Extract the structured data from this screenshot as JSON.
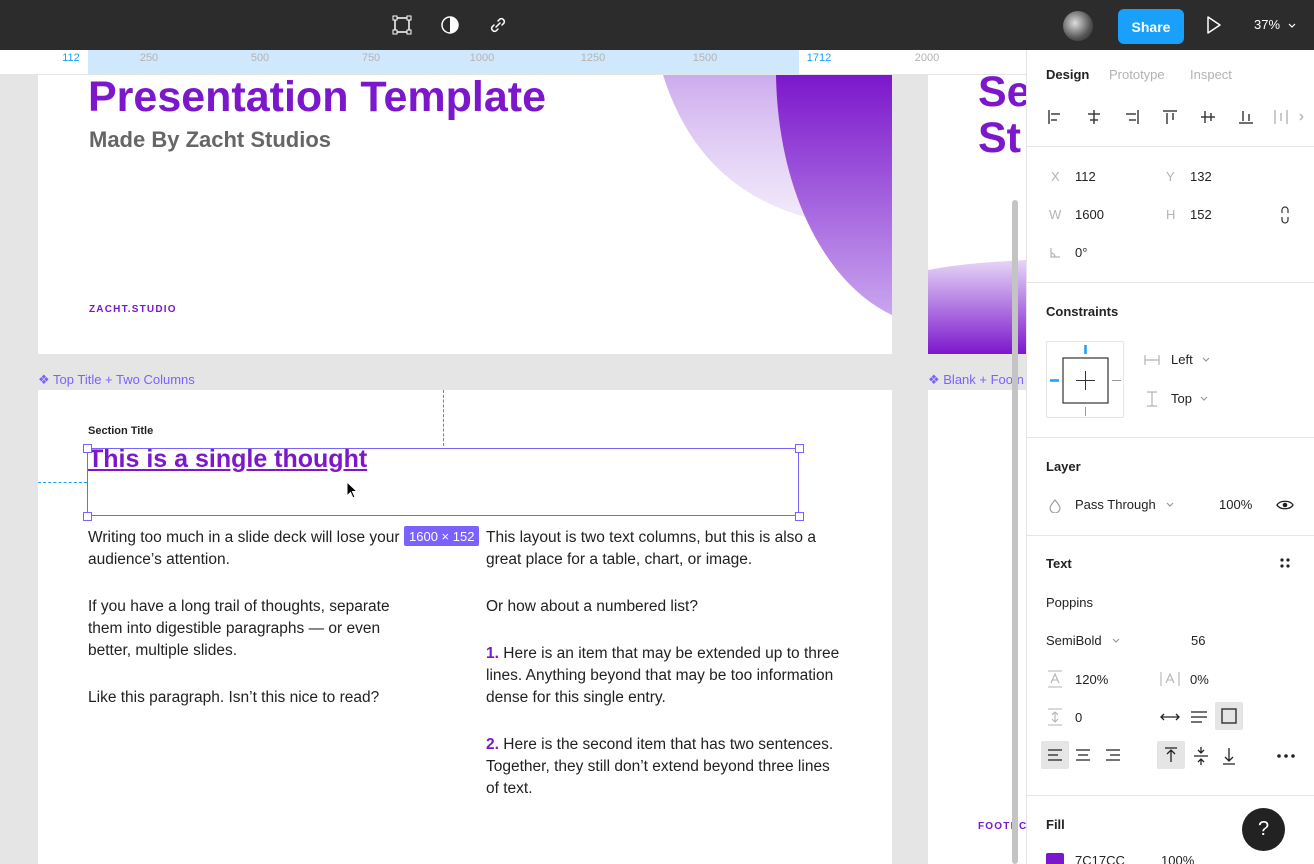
{
  "toolbar": {
    "share_label": "Share",
    "zoom": "37%",
    "icons": [
      "frame-icon",
      "contrast-icon",
      "link-icon",
      "play-icon"
    ]
  },
  "ruler": {
    "ticks": [
      "112",
      "250",
      "500",
      "750",
      "1000",
      "1250",
      "1500",
      "1712",
      "2000"
    ],
    "selected_start": "112",
    "selected_end": "1712"
  },
  "canvas": {
    "frame1": {
      "title": "Presentation Template",
      "subtitle": "Made By Zacht Studios",
      "footer": "ZACHT.STUDIO"
    },
    "frame3": {
      "title_line1": "Se",
      "title_line2": "St"
    },
    "frame2": {
      "label": "❖ Top Title + Two Columns",
      "section_title": "Section Title",
      "heading": "This is a single thought",
      "left_col": [
        "Writing too much in a slide deck will lose your audience’s attention.",
        "If you have a long trail of thoughts, separate them into digestible paragraphs — or even better, multiple slides.",
        "Like this paragraph. Isn’t this nice to read?"
      ],
      "right_col": {
        "p1": "This layout is two text columns, but this is also a great place for a table, chart, or image.",
        "p2": "Or how about a numbered list?",
        "item1_num": "1.",
        "item1": "Here is an item that may be extended up to three lines. Anything beyond that may be too information dense for this single entry.",
        "item2_num": "2.",
        "item2": "Here is the second item that has two sentences. Together, they still don’t extend beyond three lines of text."
      }
    },
    "frame4": {
      "label": "❖ Blank + Footn",
      "footer": "FOOTNC"
    },
    "selection_size": "1600 × 152"
  },
  "panel": {
    "tabs": [
      "Design",
      "Prototype",
      "Inspect"
    ],
    "x_label": "X",
    "x": "112",
    "y_label": "Y",
    "y": "132",
    "w_label": "W",
    "w": "1600",
    "h_label": "H",
    "h": "152",
    "rotation": "0°",
    "constraints": {
      "title": "Constraints",
      "horizontal": "Left",
      "vertical": "Top"
    },
    "layer": {
      "title": "Layer",
      "blend": "Pass Through",
      "opacity": "100%"
    },
    "text": {
      "title": "Text",
      "font": "Poppins",
      "weight": "SemiBold",
      "size": "56",
      "line_height": "120%",
      "letter_spacing": "0%",
      "paragraph_spacing": "0"
    },
    "fill": {
      "title": "Fill",
      "hex": "7C17CC",
      "opacity": "100%",
      "color": "#7c17cc"
    }
  },
  "help_label": "?"
}
